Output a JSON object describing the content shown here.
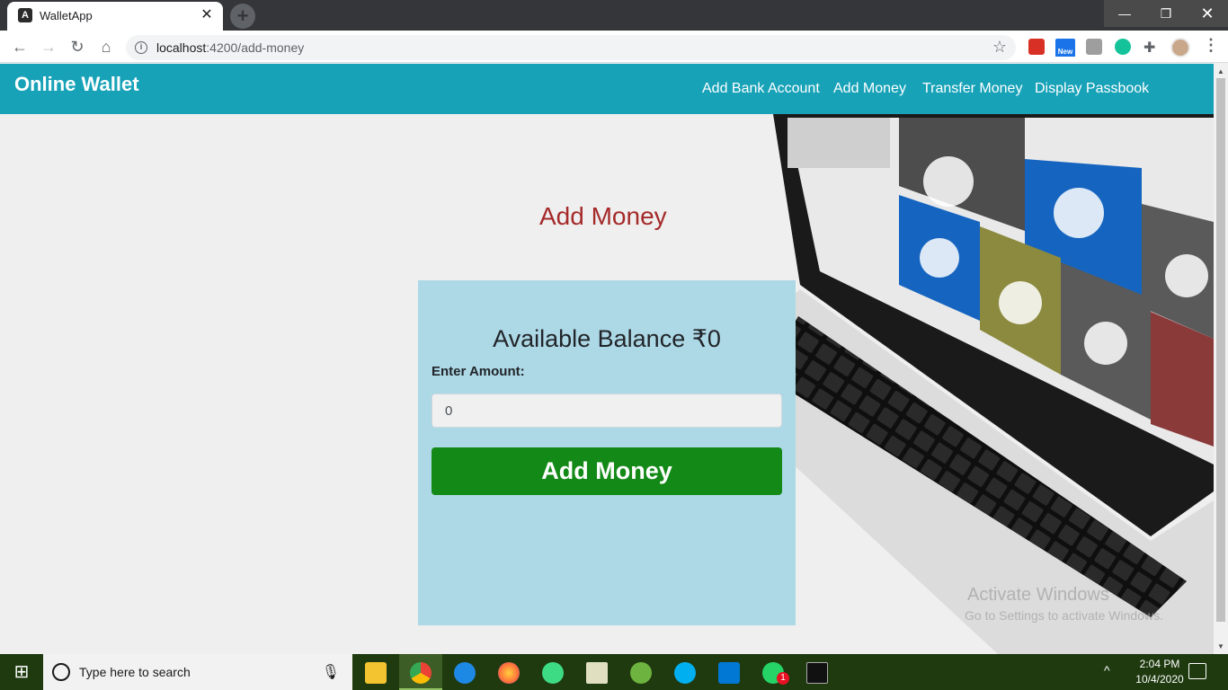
{
  "browser": {
    "tab_title": "WalletApp",
    "tab_favicon": "A",
    "tab_close": "✕",
    "new_tab": "+",
    "url_host": "localhost",
    "url_path": ":4200/add-money",
    "window_controls": {
      "minimize": "—",
      "maximize": "❐",
      "close": "✕"
    }
  },
  "navbar": {
    "brand": "Online Wallet",
    "links": [
      "Add Bank Account",
      "Add Money",
      "Transfer Money",
      "Display Passbook"
    ],
    "color": "#17a2b8"
  },
  "main": {
    "heading": "Add Money",
    "heading_color": "#a52a2a",
    "card": {
      "balance_text": "Available Balance ₹0",
      "amount_label": "Enter Amount:",
      "amount_value": "0",
      "button_label": "Add Money",
      "card_color": "#add8e6",
      "button_color": "#138a17"
    },
    "watermark": {
      "line1": "Activate Windows",
      "line2": "Go to Settings to activate Windows."
    }
  },
  "taskbar": {
    "search_placeholder": "Type here to search",
    "apps": [
      "file-explorer-icon",
      "chrome-icon",
      "edge-icon",
      "firefox-icon",
      "android-studio-icon",
      "notepad-icon",
      "spring-icon",
      "skype-icon",
      "vscode-icon",
      "whatsapp-icon",
      "terminal-icon"
    ],
    "whatsapp_badge": "1",
    "time": "2:04 PM",
    "date": "10/4/2020"
  }
}
